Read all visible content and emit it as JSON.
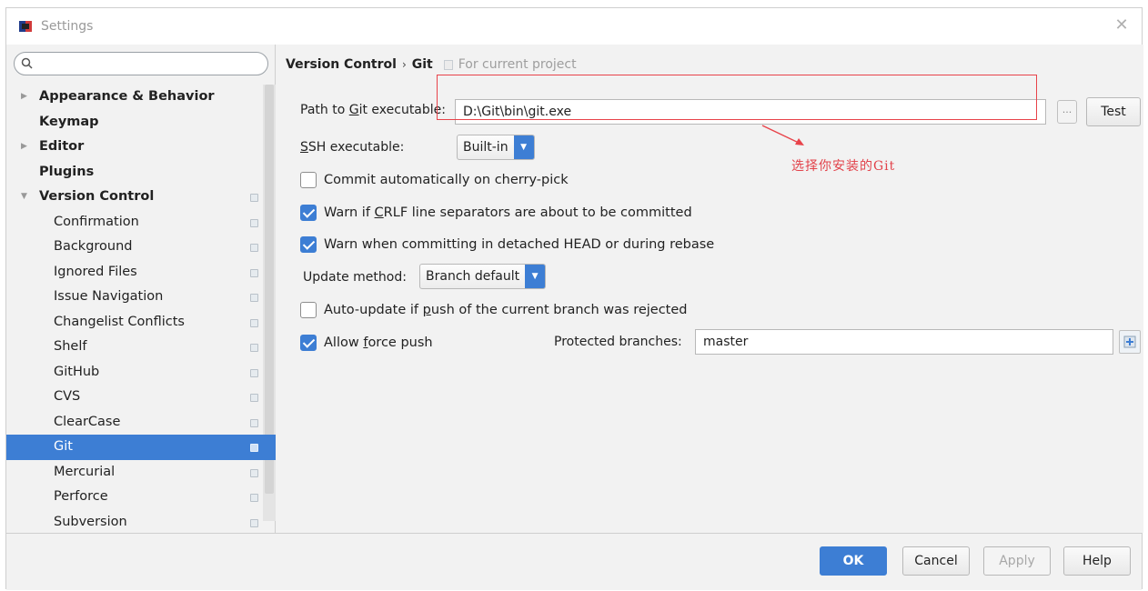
{
  "window": {
    "title": "Settings",
    "close_glyph": "✕"
  },
  "search": {
    "placeholder": "",
    "icon": "search-icon"
  },
  "sidebar": {
    "items": [
      {
        "label": "Appearance & Behavior",
        "level": "top",
        "arrow": "▶"
      },
      {
        "label": "Keymap",
        "level": "top",
        "arrow": ""
      },
      {
        "label": "Editor",
        "level": "top",
        "arrow": "▶"
      },
      {
        "label": "Plugins",
        "level": "top",
        "arrow": ""
      },
      {
        "label": "Version Control",
        "level": "top",
        "arrow": "▼"
      },
      {
        "label": "Confirmation",
        "level": "child"
      },
      {
        "label": "Background",
        "level": "child"
      },
      {
        "label": "Ignored Files",
        "level": "child"
      },
      {
        "label": "Issue Navigation",
        "level": "child"
      },
      {
        "label": "Changelist Conflicts",
        "level": "child"
      },
      {
        "label": "Shelf",
        "level": "child"
      },
      {
        "label": "GitHub",
        "level": "child"
      },
      {
        "label": "CVS",
        "level": "child"
      },
      {
        "label": "ClearCase",
        "level": "child"
      },
      {
        "label": "Git",
        "level": "child",
        "selected": true
      },
      {
        "label": "Mercurial",
        "level": "child"
      },
      {
        "label": "Perforce",
        "level": "child"
      },
      {
        "label": "Subversion",
        "level": "child"
      }
    ]
  },
  "breadcrumb": {
    "section": "Version Control",
    "separator": "›",
    "page": "Git",
    "note": "For current project"
  },
  "git": {
    "path_label_pre": "Path to ",
    "path_label_u": "G",
    "path_label_post": "it executable:",
    "path_value": "D:\\Git\\bin\\git.exe",
    "browse_label": "...",
    "test_label": "Test",
    "ssh_label_u": "S",
    "ssh_label_post": "SH executable:",
    "ssh_value": "Built-in",
    "commit_cherry": {
      "label": "Commit automatically on cherry-pick",
      "checked": false
    },
    "warn_crlf": {
      "pre": "Warn if ",
      "u": "C",
      "post": "RLF line separators are about to be committed",
      "checked": true
    },
    "warn_detached": {
      "label": "Warn when committing in detached HEAD or during rebase",
      "checked": true
    },
    "update_method_label": "Update method:",
    "update_method_value": "Branch default",
    "auto_update": {
      "pre": "Auto-update if ",
      "u": "p",
      "post": "ush of the current branch was rejected",
      "checked": false
    },
    "allow_force": {
      "pre": "Allow ",
      "u": "f",
      "post": "orce push",
      "checked": true
    },
    "protected_label": "Protected branches:",
    "protected_value": "master"
  },
  "annotation": {
    "text": "选择你安装的Git",
    "color": "#e2424a"
  },
  "footer": {
    "ok": "OK",
    "cancel": "Cancel",
    "apply": "Apply",
    "help": "Help"
  },
  "colors": {
    "accent": "#3d7ed4",
    "annotation_red": "#e8434a"
  }
}
